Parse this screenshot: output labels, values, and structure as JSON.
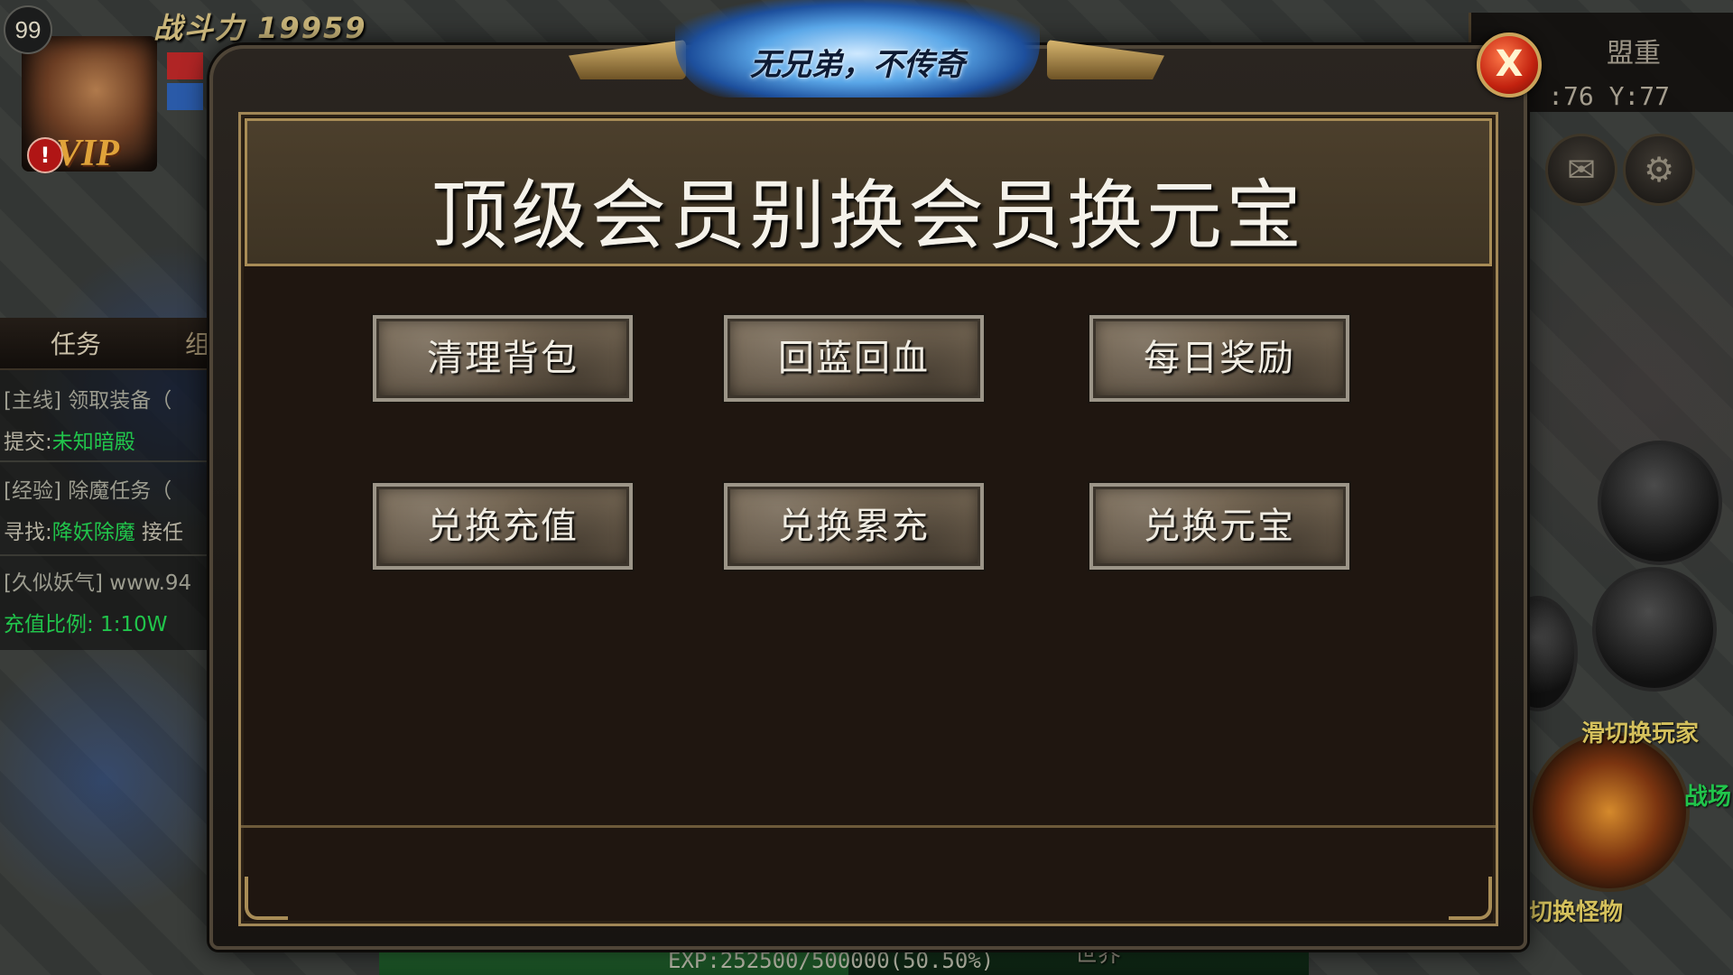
{
  "hud": {
    "level": "99",
    "combat_power_label": "战斗力",
    "combat_power_value": "19959",
    "vip_label": "VIP",
    "alert_mark": "!",
    "quest_tabs": [
      "任务",
      "组"
    ],
    "quests": [
      {
        "tag": "[主线]",
        "text": "领取装备（"
      },
      {
        "prefix": "提交:",
        "highlight": "未知暗殿"
      },
      {
        "tag": "[经验]",
        "text": "除魔任务（"
      },
      {
        "prefix": "寻找:",
        "highlight": "降妖除魔",
        "suffix": " 接任"
      },
      {
        "tag": "[久似妖气]",
        "text": "www.94"
      },
      {
        "text": "充值比例: 1:10W"
      }
    ],
    "guild_label": "盟重",
    "coords": ":76 Y:77",
    "mail_icon": "✉",
    "gear_icon": "⚙",
    "side_texts": [
      "滑切换玩家",
      "战场",
      "切换怪物"
    ],
    "exp_text": "EXP:252500/500000(50.50%)",
    "exp_fraction": 0.505,
    "world_label": "世界"
  },
  "dialog": {
    "banner_text": "无兄弟，不传奇",
    "close_label": "X",
    "title": "顶级会员别换会员换元宝",
    "buttons": [
      {
        "label": "清理背包"
      },
      {
        "label": "回蓝回血"
      },
      {
        "label": "每日奖励"
      },
      {
        "label": "兑换充值"
      },
      {
        "label": "兑换累充"
      },
      {
        "label": "兑换元宝"
      }
    ]
  }
}
